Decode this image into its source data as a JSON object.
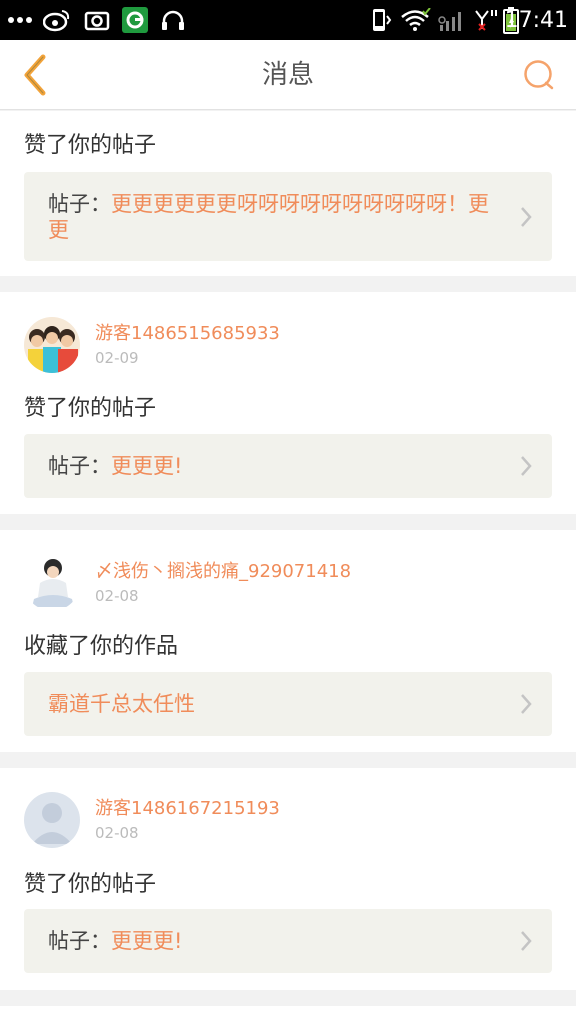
{
  "status_bar": {
    "time": "17:41",
    "left_icons": [
      "more-dots-icon",
      "weibo-icon",
      "camera-icon",
      "app-icon",
      "headphones-icon"
    ],
    "right_icons": [
      "phone-vibrate-icon",
      "wifi-icon",
      "signal-icon",
      "signal-2-icon",
      "battery-icon"
    ]
  },
  "header": {
    "title": "消息"
  },
  "colors": {
    "accent": "#f08c5a",
    "ref_bg": "#f2f2ec",
    "text": "#333333",
    "date": "#bbbbbb"
  },
  "messages": [
    {
      "action": "赞了你的帖子",
      "ref_prefix": "帖子：",
      "ref_title": "更更更更更更呀呀呀呀呀呀呀呀呀呀！更更"
    },
    {
      "user_name": "游客1486515685933",
      "date": "02-09",
      "action": "赞了你的帖子",
      "ref_prefix": "帖子：",
      "ref_title": "更更更!"
    },
    {
      "user_name": "〆浅伤丶搁浅的痛_929071418",
      "date": "02-08",
      "action": "收藏了你的作品",
      "ref_prefix": "",
      "ref_title": "霸道千总太任性"
    },
    {
      "user_name": "游客1486167215193",
      "date": "02-08",
      "action": "赞了你的帖子",
      "ref_prefix": "帖子：",
      "ref_title": "更更更!"
    }
  ]
}
